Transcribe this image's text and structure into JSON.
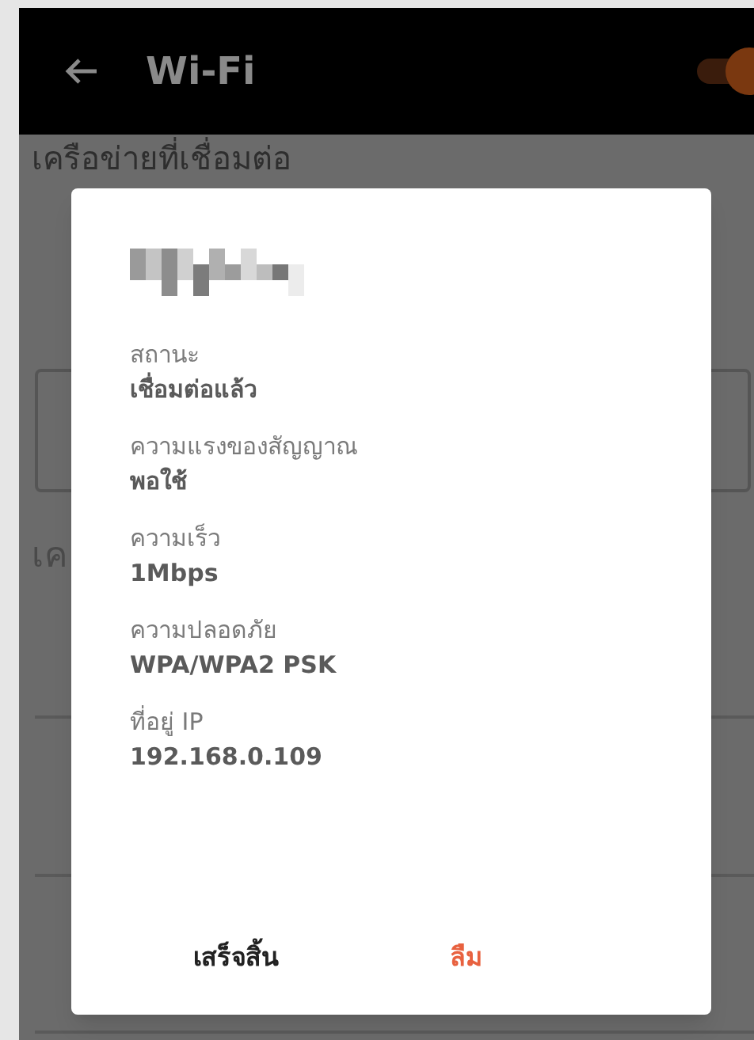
{
  "app_bar": {
    "title": "Wi-Fi",
    "wifi_on": true
  },
  "background": {
    "section_1": "เครือข่ายที่เชื่อมต่อ",
    "section_2": "เค"
  },
  "dialog": {
    "fields": [
      {
        "label": "สถานะ",
        "value": "เชื่อมต่อแล้ว"
      },
      {
        "label": "ความแรงของสัญญาณ",
        "value": "พอใช้"
      },
      {
        "label": "ความเร็ว",
        "value": "1Mbps"
      },
      {
        "label": "ความปลอดภัย",
        "value": "WPA/WPA2 PSK"
      },
      {
        "label": "ที่อยู่ IP",
        "value": "192.168.0.109"
      }
    ],
    "buttons": [
      {
        "label": "เสร็จสิ้น",
        "kind": "neutral"
      },
      {
        "label": "ลืม",
        "kind": "destructive"
      }
    ]
  }
}
